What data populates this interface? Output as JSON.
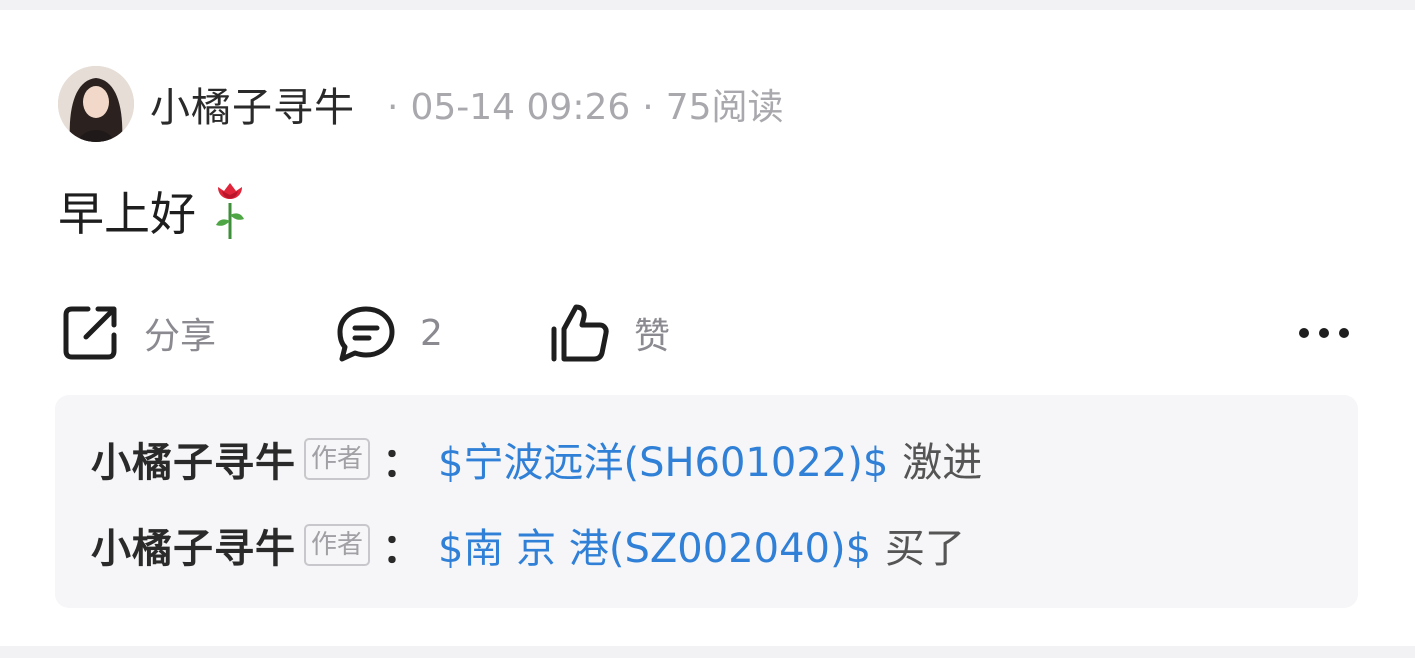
{
  "post": {
    "author": "小橘子寻牛",
    "separator": "·",
    "time": "05-14 09:26",
    "reads": "75阅读",
    "content": "早上好"
  },
  "actions": {
    "share_label": "分享",
    "comment_count": "2",
    "like_label": "赞",
    "more_label": "···"
  },
  "comments": [
    {
      "name": "小橘子寻牛",
      "badge": "作者",
      "colon": "：",
      "stock": "$宁波远洋(SH601022)$",
      "text": "激进"
    },
    {
      "name": "小橘子寻牛",
      "badge": "作者",
      "colon": "：",
      "stock": "$南 京 港(SZ002040)$",
      "text": "买了"
    }
  ],
  "colors": {
    "link_blue": "#2f80d6",
    "meta_gray": "#a8a8ad",
    "comment_bg": "#f6f6f8"
  },
  "icons": [
    "share-icon",
    "comment-icon",
    "like-icon",
    "more-icon",
    "rose-icon"
  ]
}
